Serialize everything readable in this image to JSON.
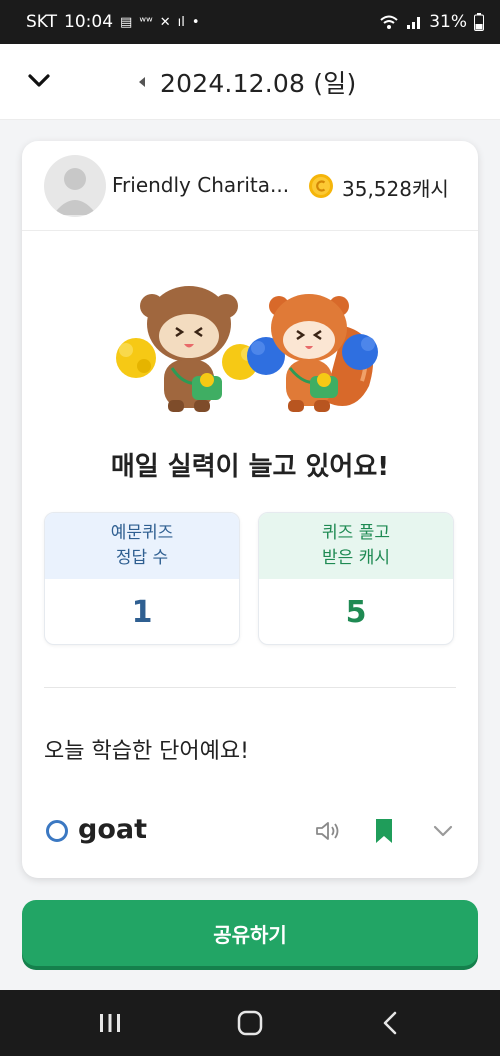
{
  "status_bar": {
    "carrier": "SKT",
    "time": "10:04",
    "battery": "31%",
    "icons": [
      "message-icon",
      "signal-weak-icon",
      "cross-icon",
      "bars-icon",
      "dot-icon",
      "wifi-icon",
      "cellular-icon",
      "battery-icon"
    ]
  },
  "header": {
    "date": "2024.12.08 (일)",
    "icons": [
      "chevron-down-icon",
      "caret-left-icon"
    ]
  },
  "profile": {
    "name": "Friendly Charita...",
    "cash": "35,528캐시",
    "coin_color": "#f5b50a"
  },
  "headline": "매일 실력이 늘고 있어요!",
  "stats": [
    {
      "label_line1": "예문퀴즈",
      "label_line2": "정답 수",
      "value": "1",
      "color": "#2f5f91",
      "bg": "#eaf2fd"
    },
    {
      "label_line1": "퀴즈 풀고",
      "label_line2": "받은 캐시",
      "value": "5",
      "color": "#1f8a53",
      "bg": "#e7f6ef"
    }
  ],
  "section_title": "오늘 학습한 단어예요!",
  "word": {
    "text": "goat",
    "icons": [
      "speaker-icon",
      "bookmark-icon",
      "chevron-down-icon"
    ]
  },
  "share_button": "공유하기",
  "colors": {
    "accent_green": "#22a565",
    "blue": "#3b78c2"
  }
}
